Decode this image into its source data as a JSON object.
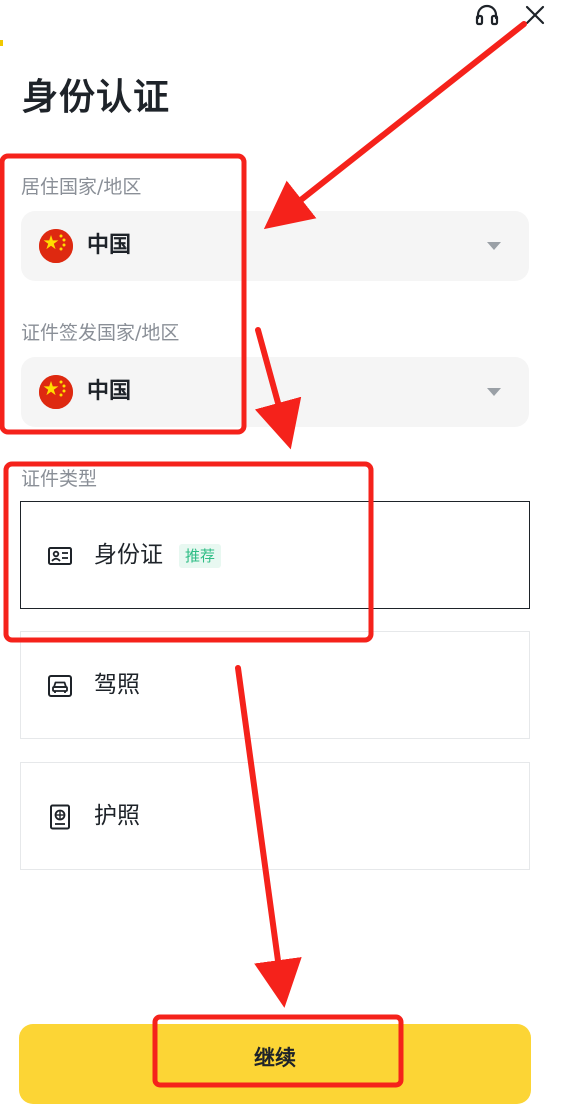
{
  "header": {
    "support_icon": "headset-icon",
    "close_icon": "close-icon"
  },
  "title": "身份认证",
  "residence": {
    "label": "居住国家/地区",
    "value": "中国",
    "flag_icon": "china-flag-icon"
  },
  "issuing": {
    "label": "证件签发国家/地区",
    "value": "中国",
    "flag_icon": "china-flag-icon"
  },
  "document_type": {
    "label": "证件类型",
    "options": [
      {
        "label": "身份证",
        "badge": "推荐",
        "icon": "id-card-icon",
        "selected": true
      },
      {
        "label": "驾照",
        "icon": "drivers-license-icon",
        "selected": false
      },
      {
        "label": "护照",
        "icon": "passport-icon",
        "selected": false
      }
    ]
  },
  "continue_label": "继续",
  "colors": {
    "accent_yellow": "#FCD535",
    "annotation_red": "#F5221B",
    "badge_green": "#2EBD85",
    "text_primary": "#1E2329",
    "text_secondary": "#8A8F97"
  }
}
